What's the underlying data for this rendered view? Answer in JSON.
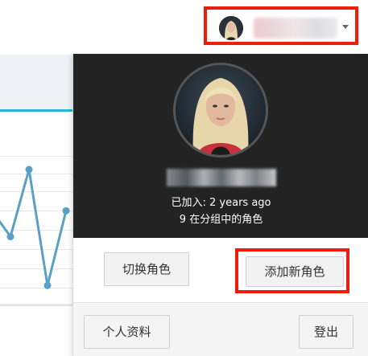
{
  "user_menu": {
    "caret_icon": "chevron-down-icon"
  },
  "profile": {
    "joined_text": "已加入: 2 years ago",
    "group_text": "9 在分组中的角色"
  },
  "actions": {
    "switch_label": "切换角色",
    "add_label": "添加新角色"
  },
  "footer": {
    "profile_label": "个人资料",
    "logout_label": "登出"
  },
  "colors": {
    "highlight": "#ee1c0a",
    "header_bg": "#232323",
    "chart_line": "#5a9fc6"
  },
  "background_chart": {
    "type": "line",
    "y": [
      62,
      45,
      89,
      13,
      62
    ]
  }
}
